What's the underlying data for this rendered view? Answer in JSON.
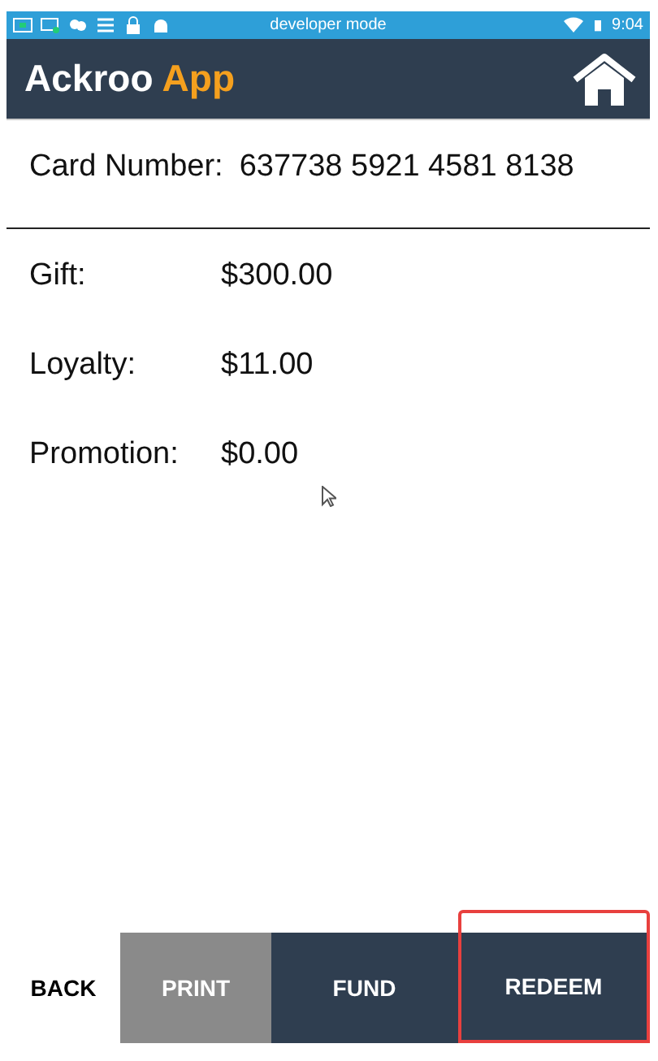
{
  "status_bar": {
    "title": "developer mode",
    "time": "9:04"
  },
  "header": {
    "title_main": "Ackroo",
    "title_accent": "App"
  },
  "card": {
    "label": "Card Number:",
    "value": "637738 5921 4581 8138"
  },
  "balances": [
    {
      "label": "Gift:",
      "value": "$300.00"
    },
    {
      "label": "Loyalty:",
      "value": "$11.00"
    },
    {
      "label": "Promotion:",
      "value": "$0.00"
    }
  ],
  "actions": [
    {
      "label": "BACK",
      "kind": "plain",
      "selected": false
    },
    {
      "label": "PRINT",
      "kind": "grey",
      "selected": false
    },
    {
      "label": "FUND",
      "kind": "dark",
      "selected": false
    },
    {
      "label": "REDEEM",
      "kind": "dark",
      "selected": true
    }
  ]
}
